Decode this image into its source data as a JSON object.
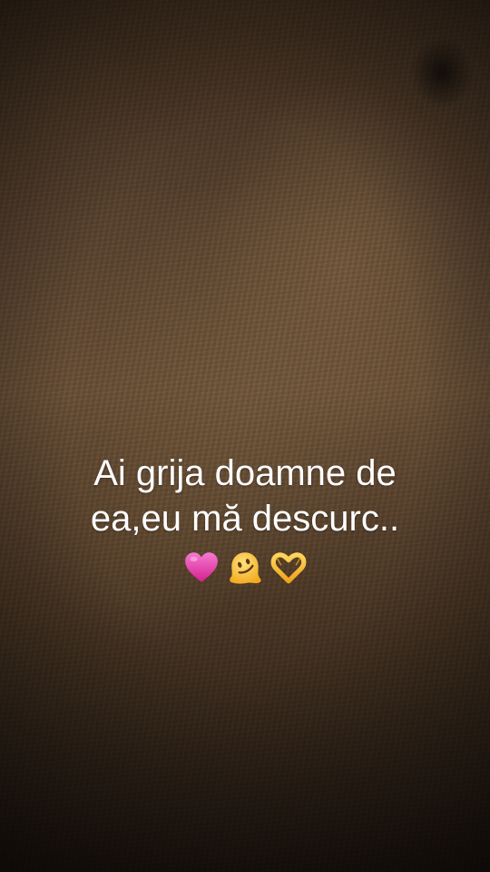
{
  "caption": {
    "line1": "Ai grija doamne de",
    "line2": "ea,eu mă descurc..",
    "emojis": [
      "pink-heart-icon",
      "melting-face-icon",
      "heart-hands-icon"
    ]
  },
  "colors": {
    "text": "#ffffff",
    "heart": "#e33aa5",
    "emoji_yellow": "#f6c12c"
  }
}
